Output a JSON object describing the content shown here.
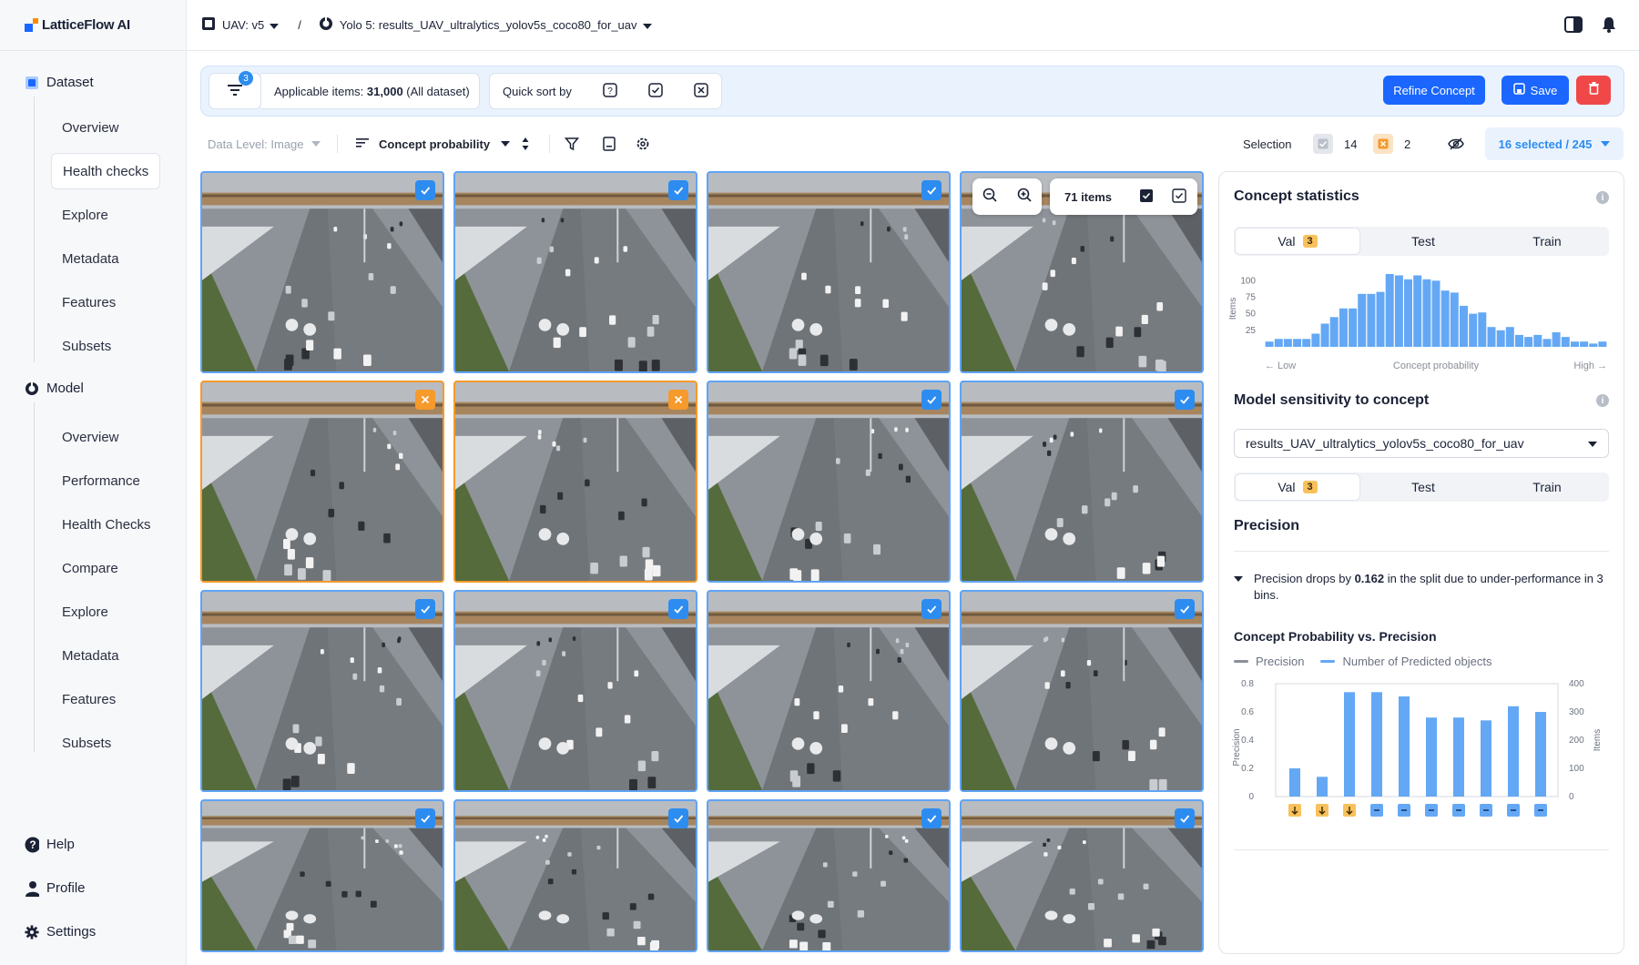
{
  "app": {
    "brand": "LatticeFlow AI"
  },
  "breadcrumb": {
    "dataset": "UAV: v5",
    "separator": "/",
    "model": "Yolo 5: results_UAV_ultralytics_yolov5s_coco80_for_uav"
  },
  "sidebar": {
    "dataset_section": "Dataset",
    "dataset_items": [
      "Overview",
      "Health checks",
      "Explore",
      "Metadata",
      "Features",
      "Subsets"
    ],
    "model_section": "Model",
    "model_items": [
      "Overview",
      "Performance",
      "Health Checks",
      "Compare",
      "Explore",
      "Metadata",
      "Features",
      "Subsets"
    ],
    "bottom": [
      "Help",
      "Profile",
      "Settings"
    ]
  },
  "filterbar": {
    "filter_count": "3",
    "applicable_label": "Applicable items:",
    "applicable_value": "31,000",
    "applicable_scope": "(All dataset)",
    "quick_sort": "Quick sort by",
    "refine": "Refine Concept",
    "save": "Save"
  },
  "toolbar": {
    "data_level": "Data Level: Image",
    "sort_by": "Concept probability",
    "selection_label": "Selection",
    "accepted_count": "14",
    "rejected_count": "2",
    "selected": "16 selected / 245"
  },
  "grid": {
    "items_count": "71 items",
    "tiles": [
      "check",
      "check",
      "check",
      "none",
      "reject",
      "reject",
      "check",
      "check",
      "check",
      "check",
      "check",
      "check",
      "check",
      "check",
      "check",
      "check"
    ]
  },
  "panel": {
    "concept_stats_title": "Concept statistics",
    "tabs": [
      "Val",
      "Test",
      "Train"
    ],
    "val_badge": "3",
    "model_sensitivity_title": "Model sensitivity to concept",
    "model_select": "results_UAV_ultralytics_yolov5s_coco80_for_uav",
    "precision_title": "Precision",
    "summary_pre": "Precision drops by",
    "summary_value": "0.162",
    "summary_post": "in the split due to under-performance in 3 bins.",
    "chart2_title": "Concept Probability vs. Precision",
    "legend_precision": "Precision",
    "legend_predicted": "Number of Predicted objects"
  },
  "chart_data": [
    {
      "type": "bar",
      "title": "",
      "xlabel": "Concept probability",
      "ylabel": "Items",
      "x_tick_left": "← Low",
      "x_tick_right": "High →",
      "yticks": [
        25,
        50,
        75,
        100
      ],
      "ylim": [
        0,
        110
      ],
      "values": [
        8,
        12,
        12,
        12,
        12,
        20,
        35,
        45,
        58,
        58,
        80,
        80,
        83,
        110,
        108,
        102,
        108,
        102,
        100,
        85,
        82,
        62,
        50,
        52,
        30,
        25,
        30,
        18,
        15,
        18,
        12,
        22,
        15,
        8,
        8,
        5,
        8
      ],
      "color": "#64a8f5"
    },
    {
      "type": "bar",
      "title": "Concept Probability vs. Precision",
      "ylabel": "Precision",
      "y2label": "Items",
      "yticks": [
        "0",
        "0.2",
        "0.4",
        "0.6",
        "0.8"
      ],
      "y2ticks": [
        "0",
        "100",
        "200",
        "300",
        "400"
      ],
      "ylim": [
        0,
        0.8
      ],
      "y2lim": [
        0,
        400
      ],
      "series": [
        {
          "name": "Number of Predicted objects",
          "values": [
            100,
            70,
            370,
            370,
            355,
            280,
            280,
            270,
            320,
            300
          ]
        }
      ],
      "bin_flags": [
        "down",
        "down",
        "down",
        "neutral",
        "neutral",
        "neutral",
        "neutral",
        "neutral",
        "neutral",
        "neutral"
      ]
    }
  ]
}
